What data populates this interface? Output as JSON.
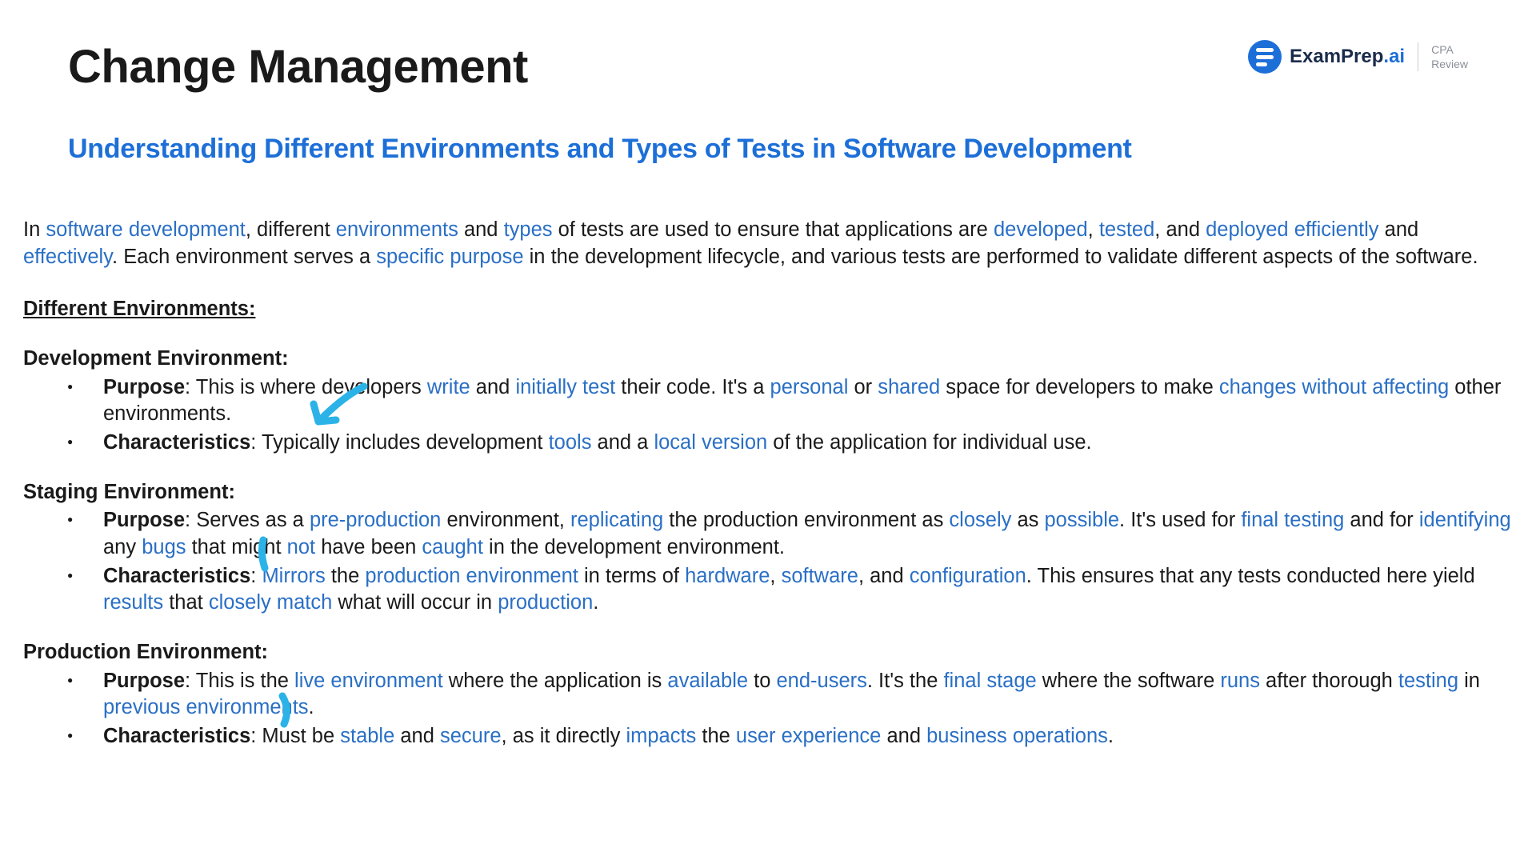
{
  "header": {
    "title": "Change Management",
    "logo_text_main": "ExamPrep",
    "logo_text_suffix": ".ai",
    "logo_sub_line1": "CPA",
    "logo_sub_line2": "Review"
  },
  "subtitle": "Understanding Different Environments and Types of Tests in Software Development",
  "intro": {
    "t1": "In ",
    "h1": "software development",
    "t2": ", different ",
    "h2": "environments",
    "t3": " and ",
    "h3": "types",
    "t4": " of tests are used to ensure that applications are ",
    "h4": "developed",
    "t5": ", ",
    "h5": "tested",
    "t6": ", and ",
    "h6": "deployed efficiently",
    "t7": " and ",
    "h7": "effectively",
    "t8": ". Each environment serves a ",
    "h8": "specific purpose",
    "t9": " in the development lifecycle, and various tests are performed to validate different aspects of the software."
  },
  "section_heading": "Different Environments:",
  "env1": {
    "title": "Development Environment",
    "purpose": {
      "label": "Purpose",
      "t1": ": This is where developers ",
      "h1": "write",
      "t2": " and ",
      "h2": "initially test",
      "t3": " their code. It's a ",
      "h3": "personal",
      "t4": " or ",
      "h4": "shared",
      "t5": " space for developers to make ",
      "h5": "changes without affecting",
      "t6": " other environments."
    },
    "char": {
      "label": "Characteristics",
      "t1": ": Typically includes development ",
      "h1": "tools",
      "t2": " and a ",
      "h2": "local version",
      "t3": " of the application for individual use."
    }
  },
  "env2": {
    "title": "Staging Environment",
    "purpose": {
      "label": "Purpose",
      "t1": ": Serves as a ",
      "h1": "pre-production",
      "t2": " environment, ",
      "h2": "replicating",
      "t3": " the production environment as ",
      "h3": "closely",
      "t4": " as ",
      "h4": "possible",
      "t5": ". It's used for ",
      "h5": "final testing",
      "t6": " and for ",
      "h6": "identifying",
      "t7": " any ",
      "h7": "bugs",
      "t8": " that might ",
      "h8": "not",
      "t9": " have been ",
      "h9": "caught",
      "t10": " in the development environment."
    },
    "char": {
      "label": "Characteristics",
      "t1": ": ",
      "h1": "Mirrors",
      "t2": " the ",
      "h2": "production environment",
      "t3": " in terms of ",
      "h3": "hardware",
      "t4": ", ",
      "h4": "software",
      "t5": ", and ",
      "h5": "configuration",
      "t6": ". This ensures that any tests conducted here yield ",
      "h6": "results",
      "t7": " that ",
      "h7": "closely match",
      "t8": " what will occur in ",
      "h8": "production",
      "t9": "."
    }
  },
  "env3": {
    "title": "Production Environment",
    "purpose": {
      "label": "Purpose",
      "t1": ": This is the ",
      "h1": "live environment",
      "t2": " where the application is ",
      "h2": "available",
      "t3": " to ",
      "h3": "end-users",
      "t4": ". It's the ",
      "h4": "final stage",
      "t5": " where the software ",
      "h5": "runs",
      "t6": " after thorough ",
      "h6": "testing",
      "t7": " in ",
      "h7": "previous environments",
      "t8": "."
    },
    "char": {
      "label": "Characteristics",
      "t1": ": Must be ",
      "h1": "stable",
      "t2": " and ",
      "h2": "secure",
      "t3": ", as it directly ",
      "h3": "impacts",
      "t4": " the ",
      "h4": "user experience",
      "t5": " and ",
      "h5": "business operations",
      "t6": "."
    }
  },
  "colors": {
    "accent": "#1d6fd8",
    "highlight": "#2a6fc5",
    "annotation": "#2bb3e8"
  }
}
